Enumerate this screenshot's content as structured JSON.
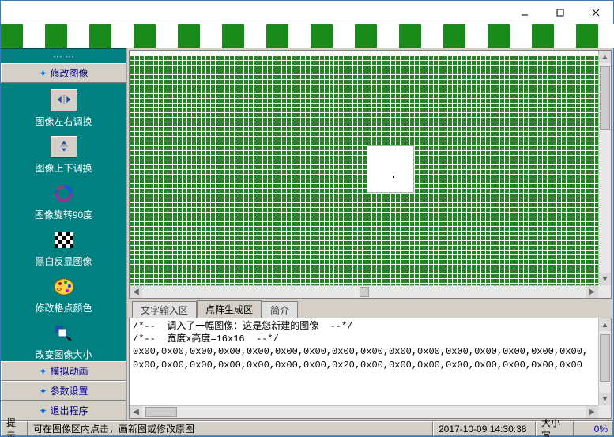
{
  "titlebar": {
    "min_tooltip": "Minimize",
    "max_tooltip": "Maximize",
    "close_tooltip": "Close"
  },
  "sidebar": {
    "truncated_top": "··· ···",
    "header": "修改图像",
    "tools": [
      {
        "label": "图像左右调换"
      },
      {
        "label": "图像上下调换"
      },
      {
        "label": "图像旋转90度"
      },
      {
        "label": "黑白反显图像"
      },
      {
        "label": "修改格点颜色"
      },
      {
        "label": "改变图像大小"
      }
    ],
    "footer": [
      "模拟动画",
      "参数设置",
      "退出程序"
    ]
  },
  "tabs": {
    "items": [
      "文字输入区",
      "点阵生成区",
      "简介"
    ],
    "active_index": 1
  },
  "code": {
    "lines": [
      "/*--  调入了一幅图像：这是您新建的图像  --*/",
      "/*--  宽度x高度=16x16  --*/",
      "0x00,0x00,0x00,0x00,0x00,0x00,0x00,0x00,0x00,0x00,0x00,0x00,0x00,0x00,0x00,0x00,",
      "0x00,0x00,0x00,0x00,0x00,0x00,0x00,0x20,0x00,0x00,0x00,0x00,0x00,0x00,0x00,0x00"
    ]
  },
  "statusbar": {
    "hint_label": "提示",
    "hint_text": "可在图像区内点击，画新图或修改原图",
    "timestamp": "2017-10-09 14:30:38",
    "caps": "大小写",
    "percent": "0%"
  }
}
